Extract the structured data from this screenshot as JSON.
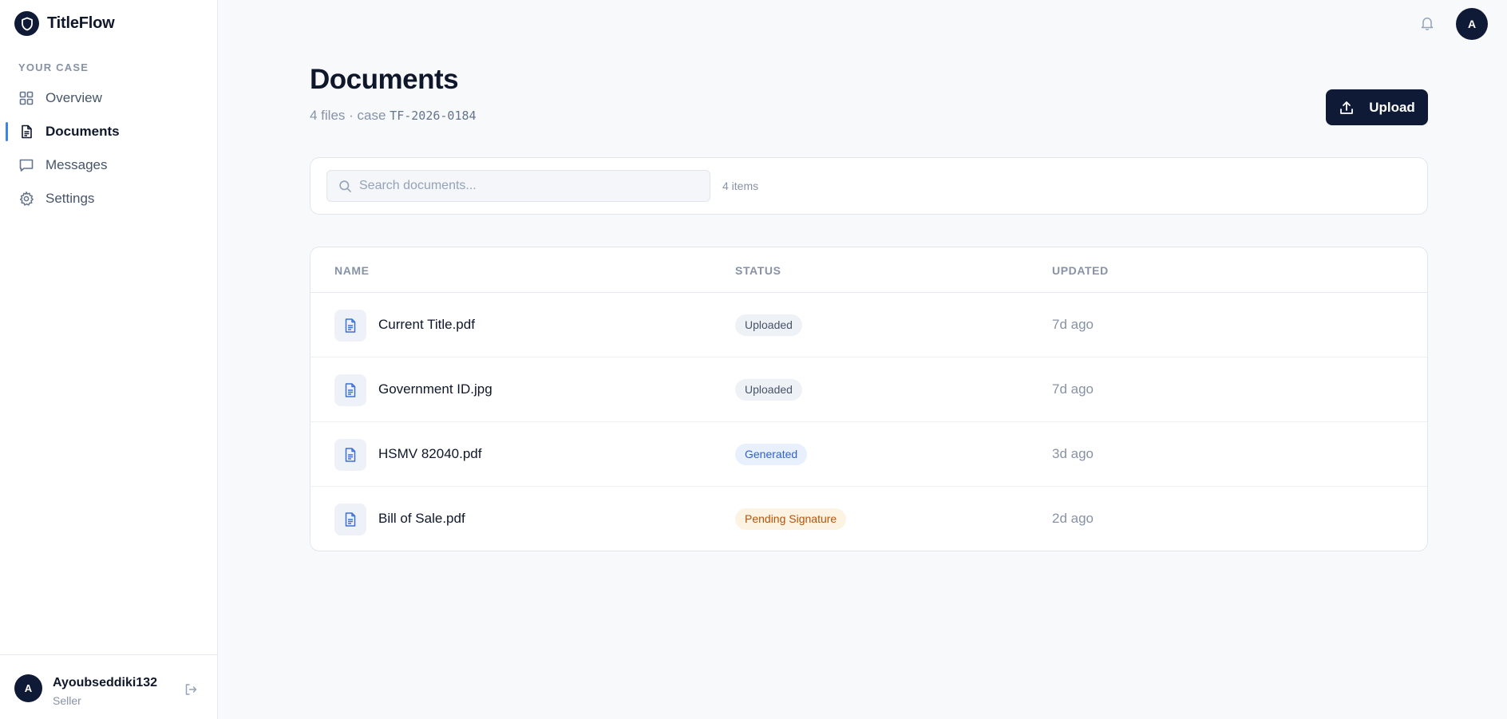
{
  "app": {
    "name": "TitleFlow"
  },
  "sidebar": {
    "section_label": "YOUR CASE",
    "items": [
      {
        "label": "Overview",
        "icon": "grid-icon",
        "active": false
      },
      {
        "label": "Documents",
        "icon": "document-icon",
        "active": true
      },
      {
        "label": "Messages",
        "icon": "message-icon",
        "active": false
      },
      {
        "label": "Settings",
        "icon": "gear-icon",
        "active": false
      }
    ],
    "user": {
      "initial": "A",
      "name": "Ayoubseddiki132",
      "role": "Seller"
    }
  },
  "topbar": {
    "avatar_initial": "A"
  },
  "header": {
    "title": "Documents",
    "subtitle_prefix": "4 files · case",
    "case_id": "TF-2026-0184",
    "upload_label": "Upload"
  },
  "search": {
    "placeholder": "Search documents...",
    "value": "",
    "count": "4 items"
  },
  "table": {
    "columns": [
      "NAME",
      "STATUS",
      "UPDATED"
    ],
    "rows": [
      {
        "name": "Current Title.pdf",
        "status": "Uploaded",
        "status_kind": "uploaded",
        "updated": "7d ago"
      },
      {
        "name": "Government ID.jpg",
        "status": "Uploaded",
        "status_kind": "uploaded",
        "updated": "7d ago"
      },
      {
        "name": "HSMV 82040.pdf",
        "status": "Generated",
        "status_kind": "generated",
        "updated": "3d ago"
      },
      {
        "name": "Bill of Sale.pdf",
        "status": "Pending Signature",
        "status_kind": "pending",
        "updated": "2d ago"
      }
    ]
  },
  "colors": {
    "brand": "#0f1a36",
    "accent": "#3b82f6",
    "status_uploaded": "#475569",
    "status_generated": "#2f62c9",
    "status_pending": "#b45309"
  }
}
